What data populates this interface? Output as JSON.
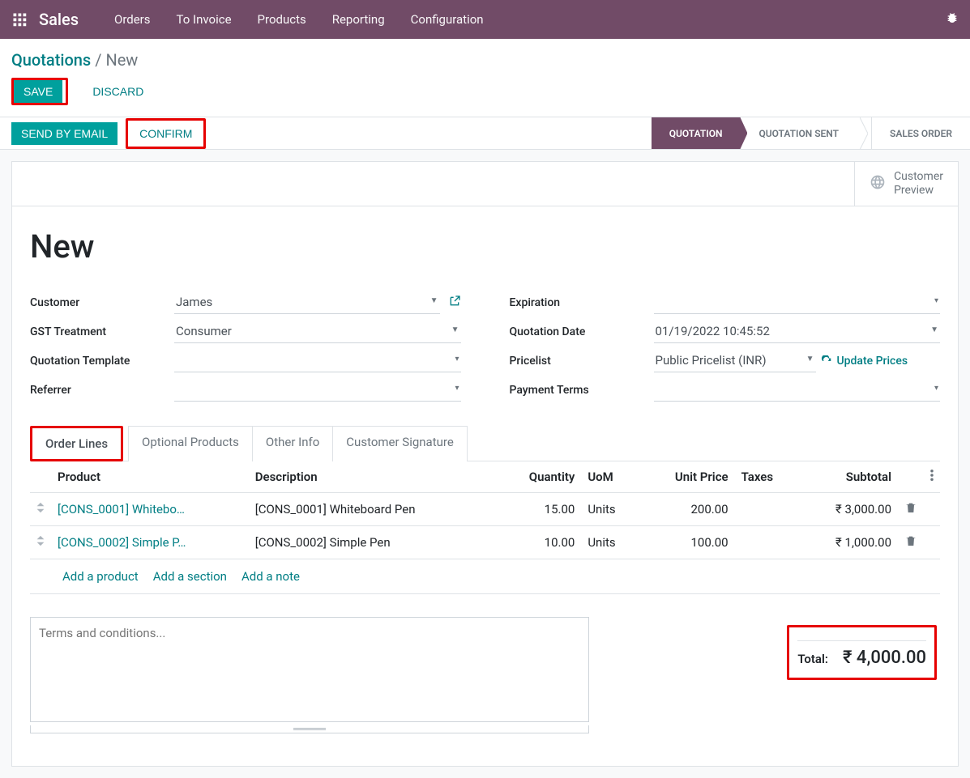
{
  "nav": {
    "brand": "Sales",
    "items": [
      "Orders",
      "To Invoice",
      "Products",
      "Reporting",
      "Configuration"
    ]
  },
  "breadcrumb": {
    "root": "Quotations",
    "sep": "/",
    "current": "New"
  },
  "buttons": {
    "save": "SAVE",
    "discard": "DISCARD",
    "send_email": "SEND BY EMAIL",
    "confirm": "CONFIRM"
  },
  "status_steps": [
    "QUOTATION",
    "QUOTATION SENT",
    "SALES ORDER"
  ],
  "customer_preview": {
    "line1": "Customer",
    "line2": "Preview"
  },
  "title": "New",
  "form": {
    "left": {
      "customer_label": "Customer",
      "customer_value": "James",
      "gst_label": "GST Treatment",
      "gst_value": "Consumer",
      "template_label": "Quotation Template",
      "template_value": "",
      "referrer_label": "Referrer",
      "referrer_value": ""
    },
    "right": {
      "expiration_label": "Expiration",
      "expiration_value": "",
      "qdate_label": "Quotation Date",
      "qdate_value": "01/19/2022 10:45:52",
      "pricelist_label": "Pricelist",
      "pricelist_value": "Public Pricelist (INR)",
      "update_prices": "Update Prices",
      "payment_label": "Payment Terms",
      "payment_value": ""
    }
  },
  "tabs": [
    "Order Lines",
    "Optional Products",
    "Other Info",
    "Customer Signature"
  ],
  "table": {
    "headers": {
      "product": "Product",
      "description": "Description",
      "qty": "Quantity",
      "uom": "UoM",
      "unit": "Unit Price",
      "taxes": "Taxes",
      "subtotal": "Subtotal"
    },
    "rows": [
      {
        "product": "[CONS_0001] Whitebo…",
        "description": "[CONS_0001] Whiteboard Pen",
        "qty": "15.00",
        "uom": "Units",
        "unit": "200.00",
        "taxes": "",
        "subtotal": "₹ 3,000.00"
      },
      {
        "product": "[CONS_0002] Simple P…",
        "description": "[CONS_0002] Simple Pen",
        "qty": "10.00",
        "uom": "Units",
        "unit": "100.00",
        "taxes": "",
        "subtotal": "₹ 1,000.00"
      }
    ],
    "add_product": "Add a product",
    "add_section": "Add a section",
    "add_note": "Add a note"
  },
  "terms_placeholder": "Terms and conditions...",
  "total": {
    "label": "Total:",
    "value": "₹ 4,000.00"
  }
}
